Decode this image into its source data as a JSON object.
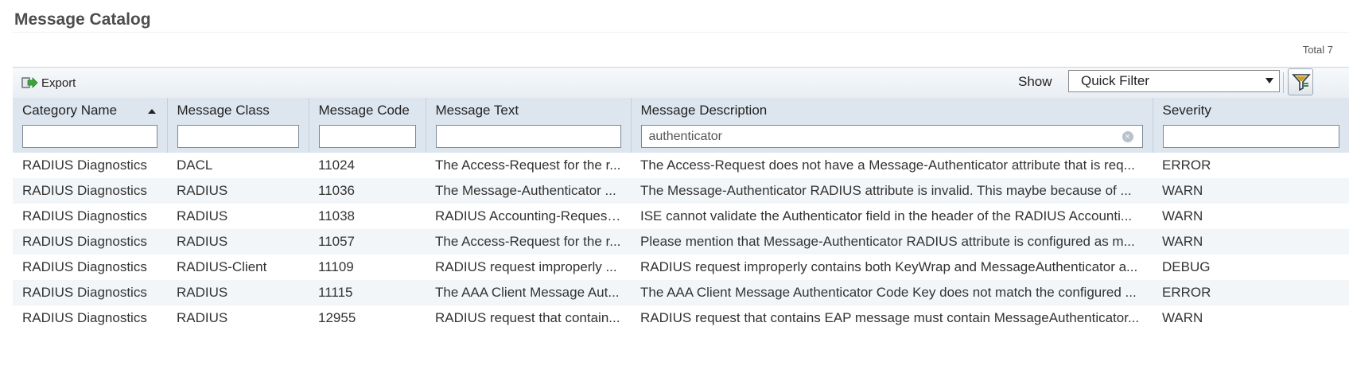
{
  "page": {
    "title": "Message Catalog",
    "total": "Total 7"
  },
  "toolbar": {
    "export_label": "Export",
    "show_label": "Show",
    "filter_value": "Quick Filter"
  },
  "columns": [
    "Category Name",
    "Message Class",
    "Message Code",
    "Message Text",
    "Message Description",
    "Severity"
  ],
  "filters": [
    "",
    "",
    "",
    "",
    "authenticator",
    ""
  ],
  "rows": [
    [
      "RADIUS Diagnostics",
      "DACL",
      "11024",
      "The Access-Request for the r...",
      "The Access-Request does not have a Message-Authenticator attribute that is req...",
      "ERROR"
    ],
    [
      "RADIUS Diagnostics",
      "RADIUS",
      "11036",
      "The Message-Authenticator ...",
      "The Message-Authenticator RADIUS attribute is invalid. This maybe because of ...",
      "WARN"
    ],
    [
      "RADIUS Diagnostics",
      "RADIUS",
      "11038",
      "RADIUS Accounting-Request...",
      "ISE cannot validate the Authenticator field in the header of the RADIUS Accounti...",
      "WARN"
    ],
    [
      "RADIUS Diagnostics",
      "RADIUS",
      "11057",
      "The Access-Request for the r...",
      "Please mention that Message-Authenticator RADIUS attribute is configured as m...",
      "WARN"
    ],
    [
      "RADIUS Diagnostics",
      "RADIUS-Client",
      "11109",
      "RADIUS request improperly ...",
      "RADIUS request improperly contains both KeyWrap and MessageAuthenticator a...",
      "DEBUG"
    ],
    [
      "RADIUS Diagnostics",
      "RADIUS",
      "11115",
      "The AAA Client Message Aut...",
      "The AAA Client Message Authenticator Code Key does not match the configured ...",
      "ERROR"
    ],
    [
      "RADIUS Diagnostics",
      "RADIUS",
      "12955",
      "RADIUS request that contain...",
      "RADIUS request that contains EAP message must contain MessageAuthenticator...",
      "WARN"
    ]
  ]
}
